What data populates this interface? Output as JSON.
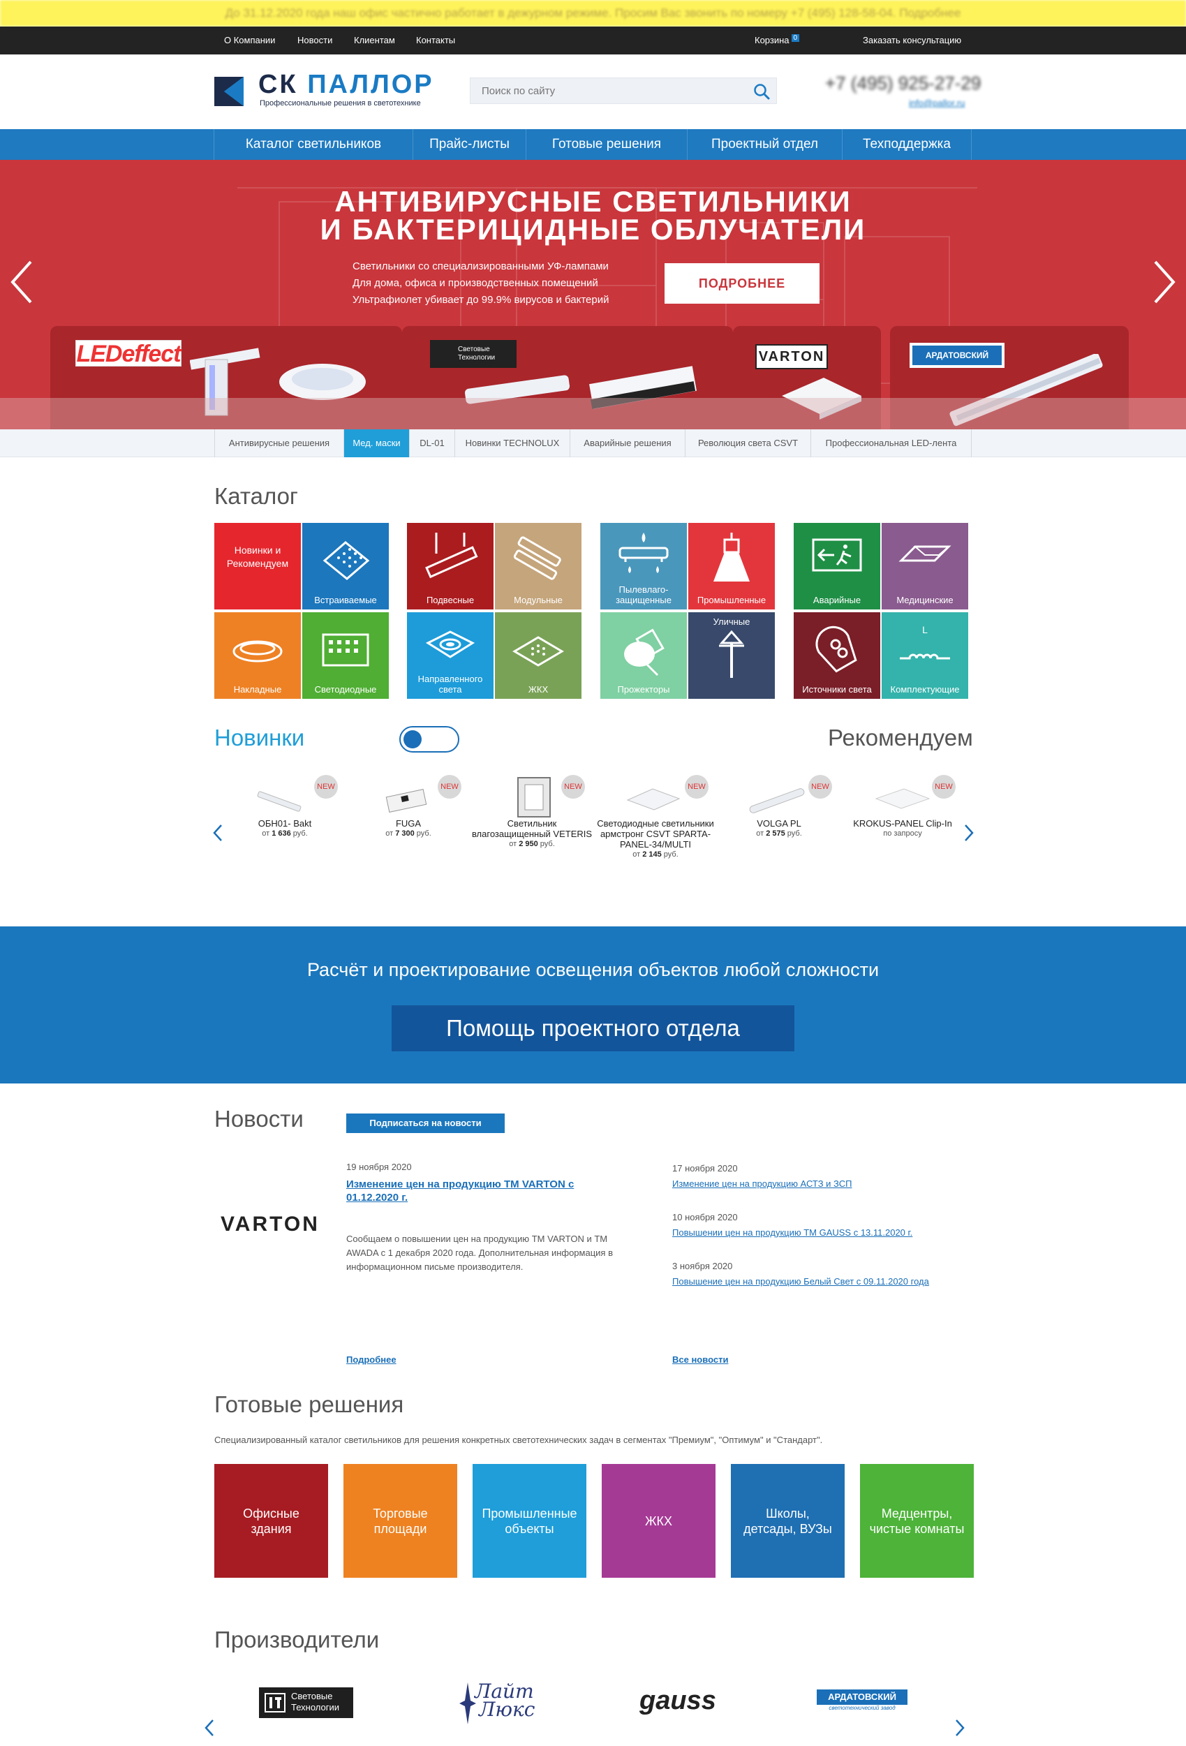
{
  "notice": "До 31.12.2020 года наш офис частично работает в дежурном режиме. Просим Вас звонить по номеру +7 (495) 128-58-04. Подробнее",
  "topbar": {
    "links": [
      "О Компании",
      "Новости",
      "Клиентам",
      "Контакты"
    ],
    "cart_label": "Корзина",
    "cart_count": "0",
    "consult_label": "Заказать консультацию"
  },
  "header": {
    "logo_part1": "СК",
    "logo_part2": "ПАЛЛОР",
    "logo_sub": "Профессиональные решения в светотехнике",
    "search_placeholder": "Поиск по сайту",
    "phone": "+7 (495) 925-27-29",
    "email": "info@pallor.ru"
  },
  "main_nav": [
    "Каталог светильников",
    "Прайс-листы",
    "Готовые решения",
    "Проектный отдел",
    "Техподдержка"
  ],
  "hero": {
    "title_line1": "АНТИВИРУСНЫЕ СВЕТИЛЬНИКИ",
    "title_line2": "И БАКТЕРИЦИДНЫЕ ОБЛУЧАТЕЛИ",
    "text_line1": "Светильники со специализированными УФ-лампами",
    "text_line2": "Для дома, офиса и производственных помещений",
    "text_line3": "Ультрафиолет убивает до 99.9% вирусов и бактерий",
    "button": "ПОДРОБНЕЕ",
    "brands": [
      "LEDeffect",
      "Световые Технологии",
      "VARTON",
      "АРДАТОВСКИЙ"
    ]
  },
  "sub_nav": {
    "items": [
      "Антивирусные решения",
      "Мед. маски",
      "DL-01",
      "Новинки TECHNOLUX",
      "Аварийные решения",
      "Революция света CSVT",
      "Профессиональная LED-лента"
    ],
    "active": 1
  },
  "catalog": {
    "title": "Каталог",
    "tiles": [
      {
        "label": "Новинки и Рекомендуем",
        "color": "#e5262d",
        "icon": "star"
      },
      {
        "label": "Встраиваемые",
        "color": "#1c77bd",
        "icon": "recessed-panel-icon"
      },
      {
        "label": "Накладные",
        "color": "#ee8124",
        "icon": "surface-light-icon"
      },
      {
        "label": "Светодиодные",
        "color": "#4fae33",
        "icon": "led-panel-icon"
      },
      {
        "label": "Подвесные",
        "color": "#ab1c1f",
        "icon": "pendant-light-icon"
      },
      {
        "label": "Модульные",
        "color": "#c5a57b",
        "icon": "modular-light-icon"
      },
      {
        "label": "Направленного света",
        "color": "#1d9cd9",
        "icon": "spot-light-icon"
      },
      {
        "label": "ЖКХ",
        "color": "#7aa257",
        "icon": "housing-light-icon"
      },
      {
        "label": "Пылевлаго-защищенные",
        "color": "#4a97bc",
        "icon": "waterproof-light-icon"
      },
      {
        "label": "Промышленные",
        "color": "#e3363c",
        "icon": "industrial-light-icon"
      },
      {
        "label": "Прожекторы",
        "color": "#7fd0a2",
        "icon": "floodlight-icon"
      },
      {
        "label": "Уличные",
        "color": "#38496b",
        "icon": "street-light-icon"
      },
      {
        "label": "Аварийные",
        "color": "#1f8f46",
        "icon": "emergency-exit-icon"
      },
      {
        "label": "Медицинские",
        "color": "#8a5b8f",
        "icon": "medical-light-icon"
      },
      {
        "label": "Источники света",
        "color": "#7a1e28",
        "icon": "bulb-icon"
      },
      {
        "label": "Комплектующие",
        "color": "#33b3ab",
        "icon": "components-icon"
      }
    ]
  },
  "products": {
    "tab_new": "Новинки",
    "tab_recommended": "Рекомендуем",
    "new_badge": "NEW",
    "items": [
      {
        "name": "ОБН01- Bakt",
        "price_prefix": "от",
        "price": "1 636",
        "currency": "руб."
      },
      {
        "name": "FUGA",
        "price_prefix": "от",
        "price": "7 300",
        "currency": "руб."
      },
      {
        "name": "Светильник влагозащищенный VETERIS",
        "price_prefix": "от",
        "price": "2 950",
        "currency": "руб."
      },
      {
        "name": "Светодиодные светильники армстронг CSVT SPARTA-PANEL-34/MULTI",
        "price_prefix": "от",
        "price": "2 145",
        "currency": "руб."
      },
      {
        "name": "VOLGA PL",
        "price_prefix": "от",
        "price": "2 575",
        "currency": "руб."
      },
      {
        "name": "KROKUS-PANEL Clip-In",
        "price_prefix": "",
        "price": "по запросу",
        "currency": ""
      }
    ]
  },
  "project": {
    "title": "Расчёт и проектирование освещения объектов любой сложности",
    "button": "Помощь проектного отдела"
  },
  "news": {
    "title": "Новости",
    "subscribe": "Подписаться на новости",
    "featured_logo": "VARTON",
    "featured": {
      "date": "19 ноября 2020",
      "title": "Изменение цен на продукцию ТМ VARTON с 01.12.2020 г.",
      "text": "Сообщаем о повышении цен на продукцию ТМ VARTON и ТМ AWADA с 1 декабря 2020 года. Дополнительная информация в информационном письме производителя.",
      "more": "Подробнее"
    },
    "items": [
      {
        "date": "17 ноября 2020",
        "title": "Изменение цен на продукцию АСТЗ и ЗСП"
      },
      {
        "date": "10 ноября 2020",
        "title": "Повышении цен на продукцию ТМ GAUSS с 13.11.2020 г."
      },
      {
        "date": "3 ноября 2020",
        "title": "Повышение цен на продукцию Белый Свет с 09.11.2020 года"
      }
    ],
    "all": "Все новости"
  },
  "solutions": {
    "title": "Готовые решения",
    "desc": "Специализированный каталог светильников для решения конкретных светотехнических задач в сегментах \"Премиум\", \"Оптимум\" и \"Стандарт\".",
    "items": [
      {
        "label": "Офисные здания",
        "color": "#a61c22"
      },
      {
        "label": "Торговые площади",
        "color": "#ee8221"
      },
      {
        "label": "Промышленные объекты",
        "color": "#1f9ed9"
      },
      {
        "label": "ЖКХ",
        "color": "#a53a95"
      },
      {
        "label": "Школы, детсады, ВУЗы",
        "color": "#1f6fb3"
      },
      {
        "label": "Медцентры, чистые комнаты",
        "color": "#4db339"
      }
    ]
  },
  "manufacturers": {
    "title": "Производители",
    "items": [
      {
        "line1": "Световые",
        "line2": "Технологии"
      },
      {
        "line1": "Лайт",
        "line2": "Люкс"
      },
      {
        "line1": "gauss",
        "line2": ""
      },
      {
        "line1": "АРДАТОВСКИЙ",
        "line2": "светотехнический завод"
      }
    ]
  }
}
